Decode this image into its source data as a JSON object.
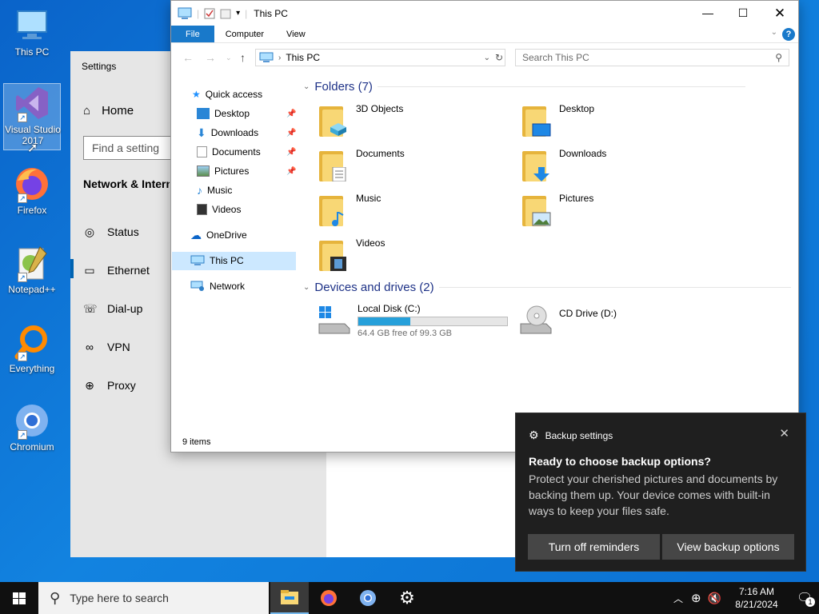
{
  "desktop": {
    "icons": [
      {
        "label": "This PC"
      },
      {
        "label": "Visual Studio 2017"
      },
      {
        "label": "Firefox"
      },
      {
        "label": "Notepad++"
      },
      {
        "label": "Everything"
      },
      {
        "label": "Chromium"
      }
    ]
  },
  "settings": {
    "title": "Settings",
    "home": "Home",
    "search_placeholder": "Find a setting",
    "section": "Network & Internet",
    "items": [
      {
        "label": "Status",
        "icon": "globe-status-icon"
      },
      {
        "label": "Ethernet",
        "icon": "ethernet-icon"
      },
      {
        "label": "Dial-up",
        "icon": "dialup-icon"
      },
      {
        "label": "VPN",
        "icon": "vpn-icon"
      },
      {
        "label": "Proxy",
        "icon": "globe-icon"
      }
    ],
    "active_item": "Ethernet"
  },
  "explorer": {
    "title": "This PC",
    "ribbon_tabs": [
      "File",
      "Computer",
      "View"
    ],
    "address": "This PC",
    "search_placeholder": "Search This PC",
    "nav": {
      "quick_access": "Quick access",
      "pinned": [
        "Desktop",
        "Downloads",
        "Documents",
        "Pictures"
      ],
      "unpinned": [
        "Music",
        "Videos"
      ],
      "onedrive": "OneDrive",
      "this_pc": "This PC",
      "network": "Network"
    },
    "folders_header": "Folders (7)",
    "folders": [
      "3D Objects",
      "Desktop",
      "Documents",
      "Downloads",
      "Music",
      "Pictures",
      "Videos"
    ],
    "drives_header": "Devices and drives (2)",
    "drives": [
      {
        "name": "Local Disk (C:)",
        "free": "64.4 GB free of 99.3 GB",
        "used_fraction": 0.352
      },
      {
        "name": "CD Drive (D:)"
      }
    ],
    "status": "9 items"
  },
  "toast": {
    "app": "Backup settings",
    "heading": "Ready to choose backup options?",
    "body": "Protect your cherished pictures and documents by backing them up. Your device comes with built-in ways to keep your files safe.",
    "btn_dismiss": "Turn off reminders",
    "btn_view": "View backup options"
  },
  "taskbar": {
    "search_placeholder": "Type here to search",
    "time": "7:16 AM",
    "date": "8/21/2024",
    "notification_count": "1"
  },
  "colors": {
    "accent": "#1979ca",
    "taskbar": "#101010",
    "toast": "#1f1f1f",
    "drive_bar": "#26a0da"
  }
}
